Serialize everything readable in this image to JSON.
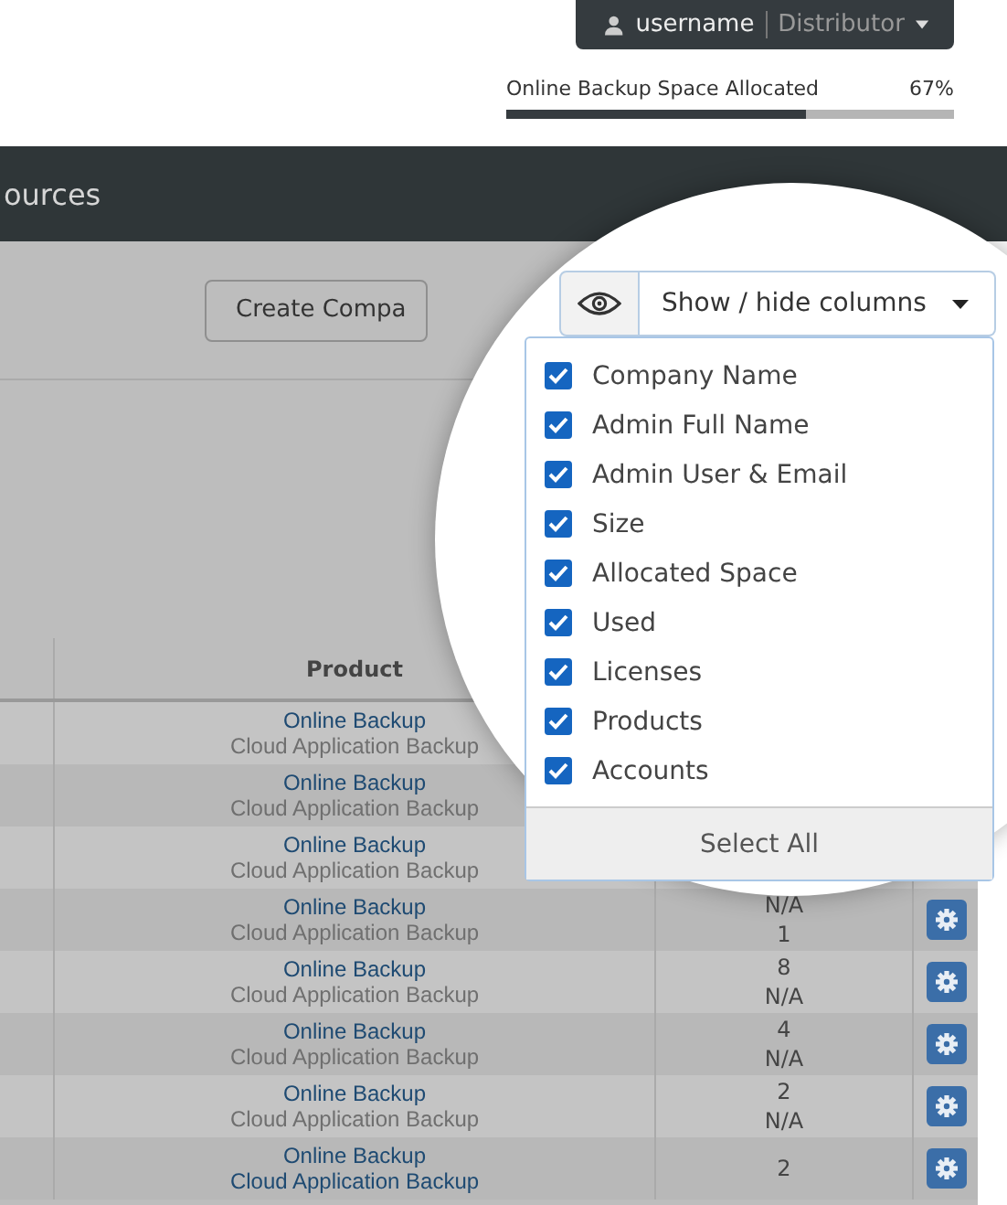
{
  "user_menu": {
    "username": "username",
    "role": "Distributor"
  },
  "storage": {
    "label": "Online Backup Space Allocated",
    "value": "67%",
    "level": 0.67
  },
  "header": {
    "title": "ources"
  },
  "create_button": "Create Compa",
  "columns_button": {
    "label": "Show / hide columns"
  },
  "column_menu": {
    "items": [
      {
        "label": "Company Name",
        "checked": true
      },
      {
        "label": "Admin Full Name",
        "checked": true
      },
      {
        "label": "Admin User & Email",
        "checked": true
      },
      {
        "label": "Size",
        "checked": true
      },
      {
        "label": "Allocated Space",
        "checked": true
      },
      {
        "label": "Used",
        "checked": true
      },
      {
        "label": "Licenses",
        "checked": true
      },
      {
        "label": "Products",
        "checked": true
      },
      {
        "label": "Accounts",
        "checked": true
      }
    ],
    "select_all": "Select All"
  },
  "table": {
    "columns": [
      "Product"
    ],
    "rows": [
      {
        "products": [
          {
            "text": "Online Backup",
            "kind": "primary"
          },
          {
            "text": "Cloud Application Backup",
            "kind": "secondary"
          }
        ],
        "licenses": []
      },
      {
        "products": [
          {
            "text": "Online Backup",
            "kind": "primary"
          },
          {
            "text": "Cloud Application Backup",
            "kind": "secondary"
          }
        ],
        "licenses": []
      },
      {
        "products": [
          {
            "text": "Online Backup",
            "kind": "primary"
          },
          {
            "text": "Cloud Application Backup",
            "kind": "secondary"
          }
        ],
        "licenses": []
      },
      {
        "products": [
          {
            "text": "Online Backup",
            "kind": "primary"
          },
          {
            "text": "Cloud Application Backup",
            "kind": "secondary"
          }
        ],
        "licenses": [
          "N/A",
          "1"
        ],
        "action": true
      },
      {
        "products": [
          {
            "text": "Online Backup",
            "kind": "primary"
          },
          {
            "text": "Cloud Application Backup",
            "kind": "secondary"
          }
        ],
        "licenses": [
          "8",
          "N/A"
        ],
        "action": true
      },
      {
        "products": [
          {
            "text": "Online Backup",
            "kind": "primary"
          },
          {
            "text": "Cloud Application Backup",
            "kind": "secondary"
          }
        ],
        "licenses": [
          "4",
          "N/A"
        ],
        "action": true
      },
      {
        "products": [
          {
            "text": "Online Backup",
            "kind": "primary"
          },
          {
            "text": "Cloud Application Backup",
            "kind": "secondary"
          }
        ],
        "licenses": [
          "2",
          "N/A"
        ],
        "action": true
      },
      {
        "products": [
          {
            "text": "Online Backup",
            "kind": "primary"
          },
          {
            "text": "Cloud Application Backup",
            "kind": "primary"
          }
        ],
        "licenses": [
          "2"
        ],
        "action": true
      }
    ]
  }
}
